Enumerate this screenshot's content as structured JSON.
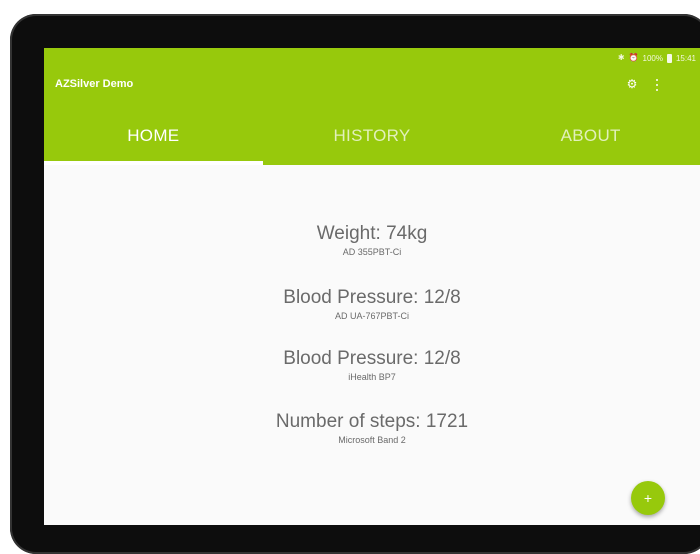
{
  "status": {
    "bluetooth_icon": "bluetooth-icon",
    "alarm_icon": "alarm-icon",
    "battery": "100%",
    "time": "15:41"
  },
  "app": {
    "title": "AZSilver Demo",
    "settings_icon": "gear-icon",
    "overflow_icon": "more-vert-icon"
  },
  "tabs": [
    {
      "label": "HOME",
      "active": true
    },
    {
      "label": "HISTORY",
      "active": false
    },
    {
      "label": "ABOUT",
      "active": false
    }
  ],
  "readings": [
    {
      "value": "Weight: 74kg",
      "device": "AD 355PBT-Ci"
    },
    {
      "value": "Blood Pressure: 12/8",
      "device": "AD UA-767PBT-Ci"
    },
    {
      "value": "Blood Pressure: 12/8",
      "device": "iHealth BP7"
    },
    {
      "value": "Number of steps: 1721",
      "device": "Microsoft Band 2"
    }
  ],
  "fab": {
    "label": "+",
    "icon": "add-icon"
  },
  "colors": {
    "accent": "#97c90c",
    "text": "#6a6a6a",
    "background": "#fafafa",
    "bezel": "#0d0d0d"
  }
}
